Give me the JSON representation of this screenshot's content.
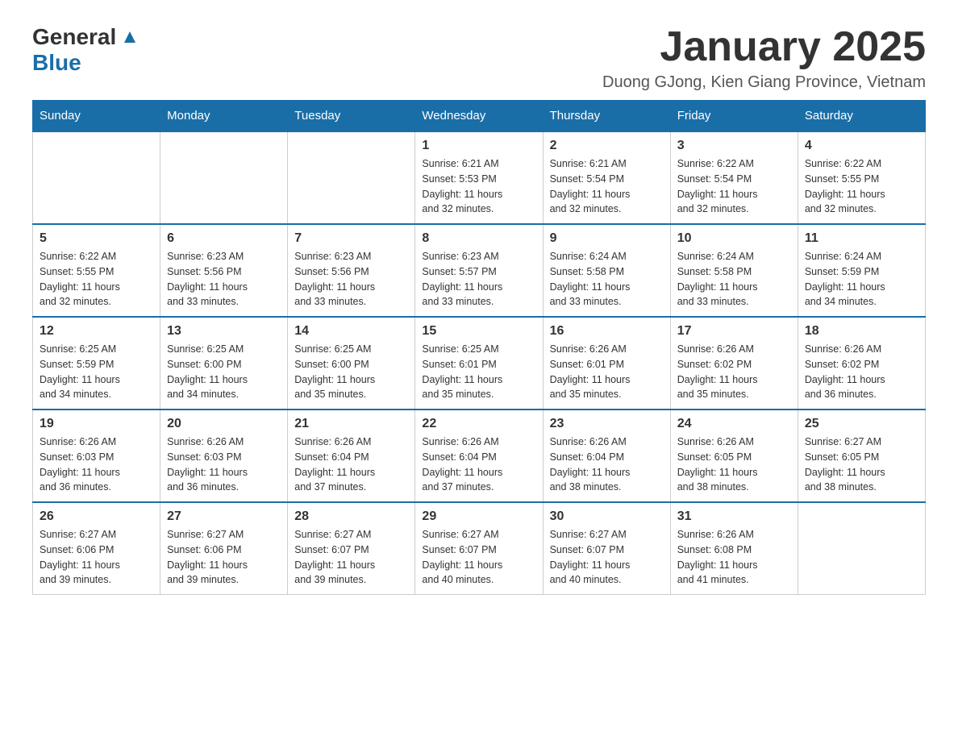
{
  "header": {
    "logo_general": "General",
    "logo_blue": "Blue",
    "month_title": "January 2025",
    "location": "Duong GJong, Kien Giang Province, Vietnam"
  },
  "days_of_week": [
    "Sunday",
    "Monday",
    "Tuesday",
    "Wednesday",
    "Thursday",
    "Friday",
    "Saturday"
  ],
  "weeks": [
    [
      {
        "day": "",
        "info": ""
      },
      {
        "day": "",
        "info": ""
      },
      {
        "day": "",
        "info": ""
      },
      {
        "day": "1",
        "info": "Sunrise: 6:21 AM\nSunset: 5:53 PM\nDaylight: 11 hours\nand 32 minutes."
      },
      {
        "day": "2",
        "info": "Sunrise: 6:21 AM\nSunset: 5:54 PM\nDaylight: 11 hours\nand 32 minutes."
      },
      {
        "day": "3",
        "info": "Sunrise: 6:22 AM\nSunset: 5:54 PM\nDaylight: 11 hours\nand 32 minutes."
      },
      {
        "day": "4",
        "info": "Sunrise: 6:22 AM\nSunset: 5:55 PM\nDaylight: 11 hours\nand 32 minutes."
      }
    ],
    [
      {
        "day": "5",
        "info": "Sunrise: 6:22 AM\nSunset: 5:55 PM\nDaylight: 11 hours\nand 32 minutes."
      },
      {
        "day": "6",
        "info": "Sunrise: 6:23 AM\nSunset: 5:56 PM\nDaylight: 11 hours\nand 33 minutes."
      },
      {
        "day": "7",
        "info": "Sunrise: 6:23 AM\nSunset: 5:56 PM\nDaylight: 11 hours\nand 33 minutes."
      },
      {
        "day": "8",
        "info": "Sunrise: 6:23 AM\nSunset: 5:57 PM\nDaylight: 11 hours\nand 33 minutes."
      },
      {
        "day": "9",
        "info": "Sunrise: 6:24 AM\nSunset: 5:58 PM\nDaylight: 11 hours\nand 33 minutes."
      },
      {
        "day": "10",
        "info": "Sunrise: 6:24 AM\nSunset: 5:58 PM\nDaylight: 11 hours\nand 33 minutes."
      },
      {
        "day": "11",
        "info": "Sunrise: 6:24 AM\nSunset: 5:59 PM\nDaylight: 11 hours\nand 34 minutes."
      }
    ],
    [
      {
        "day": "12",
        "info": "Sunrise: 6:25 AM\nSunset: 5:59 PM\nDaylight: 11 hours\nand 34 minutes."
      },
      {
        "day": "13",
        "info": "Sunrise: 6:25 AM\nSunset: 6:00 PM\nDaylight: 11 hours\nand 34 minutes."
      },
      {
        "day": "14",
        "info": "Sunrise: 6:25 AM\nSunset: 6:00 PM\nDaylight: 11 hours\nand 35 minutes."
      },
      {
        "day": "15",
        "info": "Sunrise: 6:25 AM\nSunset: 6:01 PM\nDaylight: 11 hours\nand 35 minutes."
      },
      {
        "day": "16",
        "info": "Sunrise: 6:26 AM\nSunset: 6:01 PM\nDaylight: 11 hours\nand 35 minutes."
      },
      {
        "day": "17",
        "info": "Sunrise: 6:26 AM\nSunset: 6:02 PM\nDaylight: 11 hours\nand 35 minutes."
      },
      {
        "day": "18",
        "info": "Sunrise: 6:26 AM\nSunset: 6:02 PM\nDaylight: 11 hours\nand 36 minutes."
      }
    ],
    [
      {
        "day": "19",
        "info": "Sunrise: 6:26 AM\nSunset: 6:03 PM\nDaylight: 11 hours\nand 36 minutes."
      },
      {
        "day": "20",
        "info": "Sunrise: 6:26 AM\nSunset: 6:03 PM\nDaylight: 11 hours\nand 36 minutes."
      },
      {
        "day": "21",
        "info": "Sunrise: 6:26 AM\nSunset: 6:04 PM\nDaylight: 11 hours\nand 37 minutes."
      },
      {
        "day": "22",
        "info": "Sunrise: 6:26 AM\nSunset: 6:04 PM\nDaylight: 11 hours\nand 37 minutes."
      },
      {
        "day": "23",
        "info": "Sunrise: 6:26 AM\nSunset: 6:04 PM\nDaylight: 11 hours\nand 38 minutes."
      },
      {
        "day": "24",
        "info": "Sunrise: 6:26 AM\nSunset: 6:05 PM\nDaylight: 11 hours\nand 38 minutes."
      },
      {
        "day": "25",
        "info": "Sunrise: 6:27 AM\nSunset: 6:05 PM\nDaylight: 11 hours\nand 38 minutes."
      }
    ],
    [
      {
        "day": "26",
        "info": "Sunrise: 6:27 AM\nSunset: 6:06 PM\nDaylight: 11 hours\nand 39 minutes."
      },
      {
        "day": "27",
        "info": "Sunrise: 6:27 AM\nSunset: 6:06 PM\nDaylight: 11 hours\nand 39 minutes."
      },
      {
        "day": "28",
        "info": "Sunrise: 6:27 AM\nSunset: 6:07 PM\nDaylight: 11 hours\nand 39 minutes."
      },
      {
        "day": "29",
        "info": "Sunrise: 6:27 AM\nSunset: 6:07 PM\nDaylight: 11 hours\nand 40 minutes."
      },
      {
        "day": "30",
        "info": "Sunrise: 6:27 AM\nSunset: 6:07 PM\nDaylight: 11 hours\nand 40 minutes."
      },
      {
        "day": "31",
        "info": "Sunrise: 6:26 AM\nSunset: 6:08 PM\nDaylight: 11 hours\nand 41 minutes."
      },
      {
        "day": "",
        "info": ""
      }
    ]
  ]
}
